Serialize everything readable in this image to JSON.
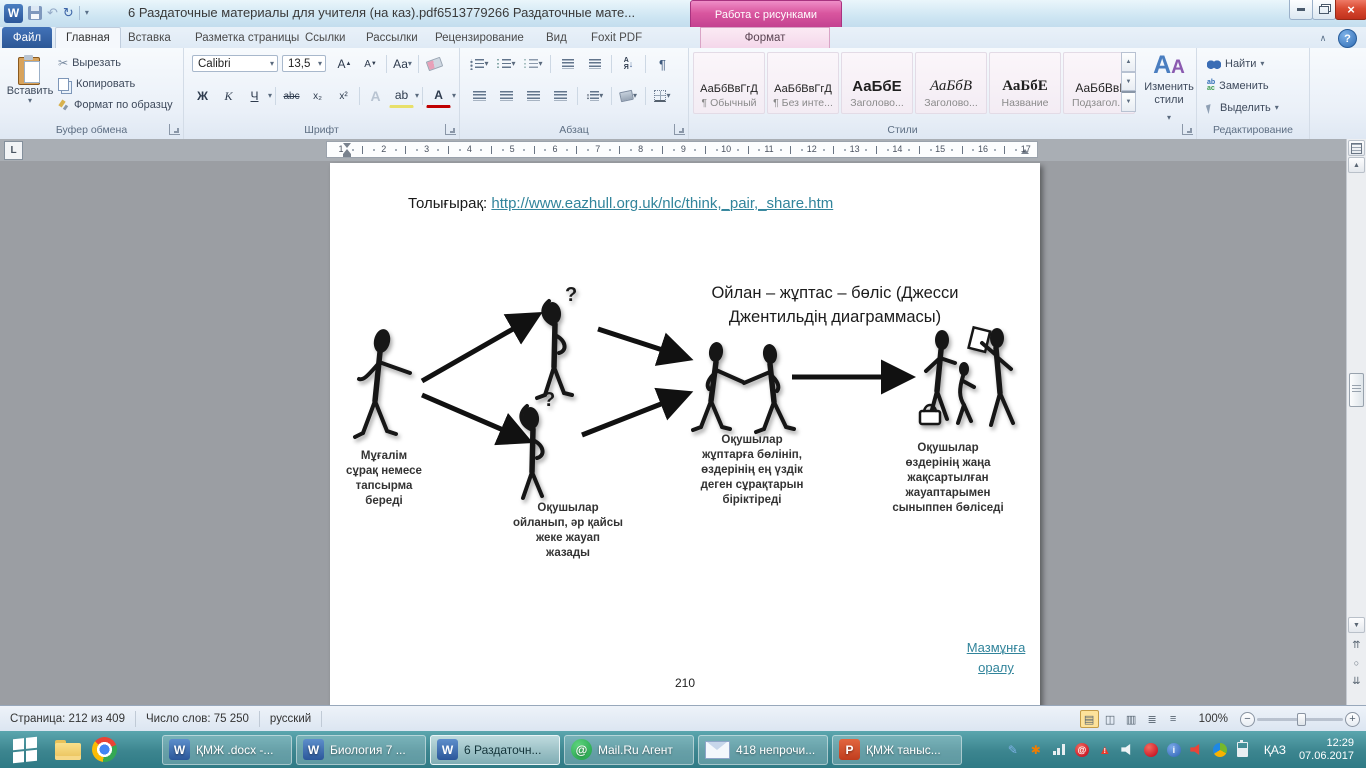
{
  "colors": {
    "accent_blue": "#2b579a",
    "contextual_pink": "#c2408f",
    "link_teal": "#31849b",
    "taskbar_teal": "#3c858f",
    "close_red": "#c0311c"
  },
  "window": {
    "title": "6 Раздаточные материалы для учителя (на каз).pdf6513779266 Раздаточные мате...",
    "contextual_group": "Работа с рисунками"
  },
  "tabs": {
    "file": "Файл",
    "items": [
      "Главная",
      "Вставка",
      "Разметка страницы",
      "Ссылки",
      "Рассылки",
      "Рецензирование",
      "Вид",
      "Foxit PDF"
    ],
    "contextual": "Формат"
  },
  "ribbon": {
    "clipboard": {
      "group": "Буфер обмена",
      "paste": "Вставить",
      "cut": "Вырезать",
      "copy": "Копировать",
      "format_painter": "Формат по образцу"
    },
    "font": {
      "group": "Шрифт",
      "name": "Calibri",
      "size": "13,5",
      "bold": "Ж",
      "italic": "К",
      "underline": "Ч",
      "strike": "abc",
      "subscript": "x₂",
      "superscript": "x²",
      "grow": "А",
      "shrink": "А",
      "case": "Аа",
      "effects": "А",
      "highlight": "ab",
      "color": "А"
    },
    "paragraph": {
      "group": "Абзац",
      "sort_a": "А",
      "sort_z": "Я"
    },
    "styles": {
      "group": "Стили",
      "items": [
        {
          "preview": "АаБбВвГгД",
          "label": "¶ Обычный"
        },
        {
          "preview": "АаБбВвГгД",
          "label": "¶ Без инте..."
        },
        {
          "preview": "АаБбЕ",
          "label": "Заголово..."
        },
        {
          "preview": "АаБбВ",
          "label": "Заголово..."
        },
        {
          "preview": "АаБбЕ",
          "label": "Название"
        },
        {
          "preview": "АаБбВвІ",
          "label": "Подзагол..."
        }
      ]
    },
    "change_styles": {
      "label": "Изменить\nстили",
      "letter": "А"
    },
    "editing": {
      "group": "Редактирование",
      "find": "Найти",
      "replace": "Заменить",
      "select": "Выделить",
      "replace_top": "ab",
      "replace_bottom": "ac"
    }
  },
  "ruler": {
    "tab_selector": "L",
    "numbers": [
      "1",
      "2",
      "3",
      "4",
      "5",
      "6",
      "7",
      "8",
      "9",
      "10",
      "11",
      "12",
      "13",
      "14",
      "15",
      "16",
      "17"
    ]
  },
  "document": {
    "more_label": "Толығырақ:",
    "link": "http://www.eazhull.org.uk/nlc/think,_pair,_share.htm",
    "diagram": {
      "title": "Ойлан – жұптас – бөліс (Джесси\nДжентильдің диаграммасы)",
      "question_mark": "?",
      "caption_teacher": "Мұғалім\nсұрақ немесе\nтапсырма\nбереді",
      "caption_think": "Оқушылар\nойланып, әр қайсы\nжеке  жауап\nжазады",
      "caption_pair": "Оқушылар\nжұптарға бөлініп,\nөздерінің  ең  үздік\nдеген  сұрақтарын\nбіріктіреді",
      "caption_share": "Оқушылар\nөздерінің жаңа\nжақсартылған\nжауаптарымен\nсыныппен бөліседі"
    },
    "back_link": "Мазмұнға\nоралу",
    "page_number": "210"
  },
  "status": {
    "page": "Страница: 212 из 409",
    "words": "Число слов: 75 250",
    "language": "русский",
    "zoom": "100%"
  },
  "taskbar": {
    "items": [
      {
        "label": "ҚМЖ .docx -..."
      },
      {
        "label": "Биология  7 ..."
      },
      {
        "label": "6 Раздаточн..."
      },
      {
        "label": "Mail.Ru Агент"
      },
      {
        "label": "418 непрочи..."
      },
      {
        "label": "ҚМЖ таныс..."
      }
    ],
    "language": "ҚАЗ",
    "time": "12:29",
    "date": "07.06.2017"
  },
  "icons": {
    "word_w": "W",
    "undo": "↶",
    "redo": "↻",
    "dropdown": "▾",
    "close": "×",
    "collapse_ribbon": "∧",
    "help": "?",
    "cut": "✂",
    "pilcrow": "¶",
    "arrow_down": "↓",
    "scroll_up": "▲",
    "scroll_down": "▼",
    "spacing": "↕",
    "view_print": "▤",
    "view_read": "◫",
    "view_web": "▥",
    "view_outline": "≣",
    "view_draft": "≡",
    "zoom_out": "−",
    "zoom_in": "+",
    "prev_page": "⇈",
    "browse": "○",
    "next_page": "⇊",
    "mail_at": "@",
    "warning": "▲",
    "excl": "!",
    "tray_pen": "✎",
    "tray_star": "✱",
    "ppt_p": "P",
    "agent_i": "i"
  }
}
